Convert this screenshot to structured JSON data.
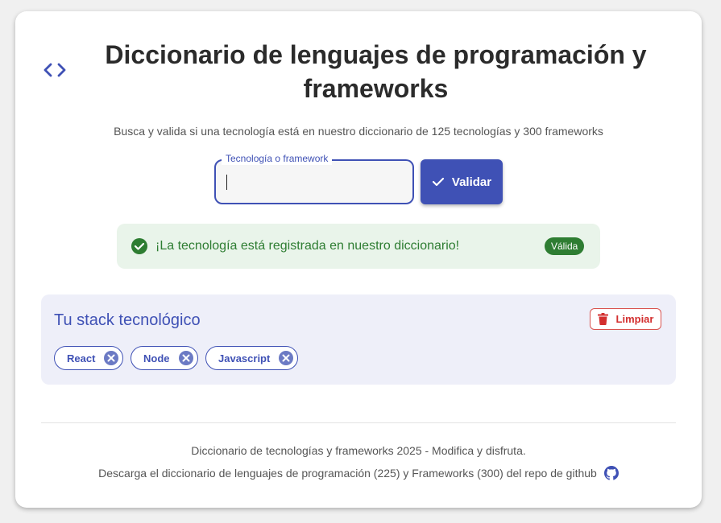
{
  "header": {
    "icon": "code-icon",
    "title": "Diccionario de lenguajes de programación y frameworks",
    "subtitle": "Busca y valida si una tecnología está en nuestro diccionario de 125 tecnologías y 300 frameworks"
  },
  "search": {
    "label": "Tecnología o framework",
    "value": "",
    "button_label": "Validar",
    "button_icon": "check-icon"
  },
  "alert": {
    "icon": "check-circle-icon",
    "message": "¡La tecnología está registrada en nuestro diccionario!",
    "badge": "Válida"
  },
  "stack": {
    "title": "Tu stack tecnológico",
    "clear_label": "Limpiar",
    "clear_icon": "trash-icon",
    "chips": [
      {
        "label": "React"
      },
      {
        "label": "Node"
      },
      {
        "label": "Javascript"
      }
    ]
  },
  "footer": {
    "line1": "Diccionario de tecnologías y frameworks 2025 - Modifica y disfruta.",
    "line2": "Descarga el diccionario de lenguajes de programación (225) y Frameworks (300) del repo de github",
    "link_icon": "github-icon"
  },
  "colors": {
    "primary": "#3f51b5",
    "success": "#2e7d32",
    "danger": "#d32f2f"
  }
}
